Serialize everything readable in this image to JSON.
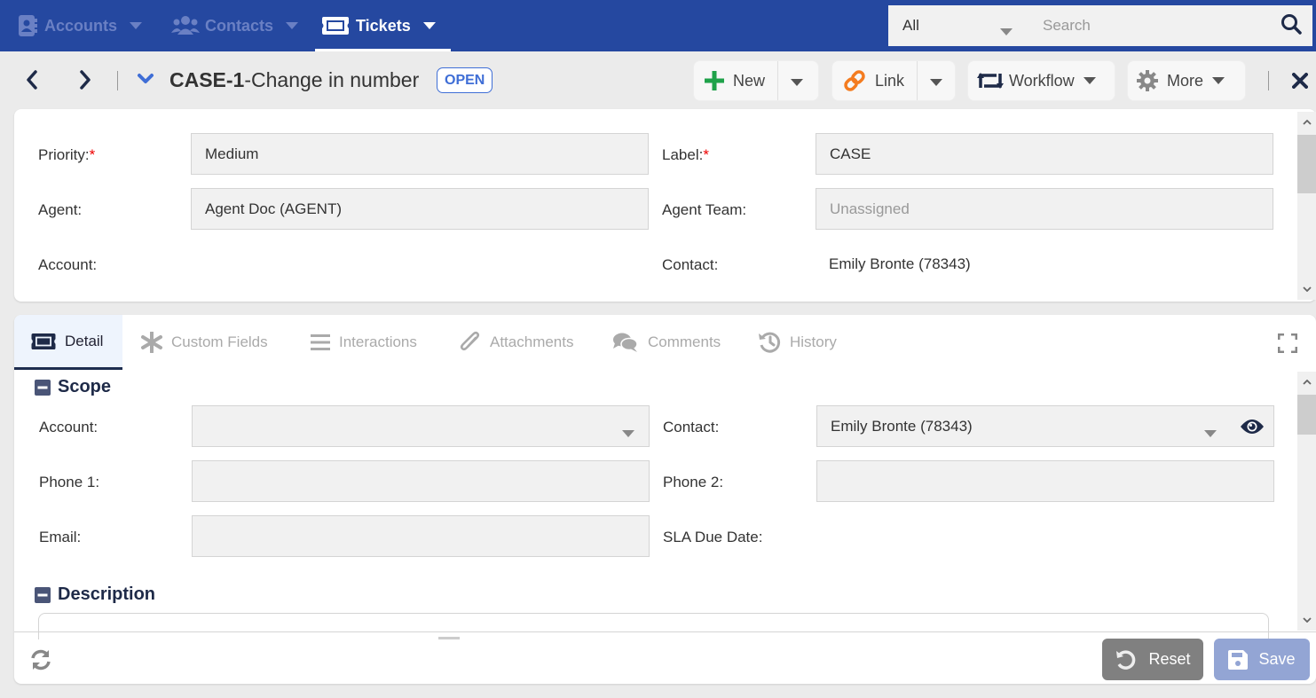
{
  "topnav": {
    "tabs": [
      {
        "label": "Accounts",
        "icon": "address-book-icon",
        "active": false
      },
      {
        "label": "Contacts",
        "icon": "users-icon",
        "active": false
      },
      {
        "label": "Tickets",
        "icon": "ticket-icon",
        "active": true
      }
    ],
    "search": {
      "scope_value": "All",
      "placeholder": "Search",
      "value": ""
    }
  },
  "titlebar": {
    "case_id": "CASE-1",
    "case_title": "-Change in number",
    "status": "OPEN",
    "buttons": {
      "new_label": "New",
      "link_label": "Link",
      "workflow_label": "Workflow",
      "more_label": "More"
    }
  },
  "header_fields": {
    "priority": {
      "label": "Priority:",
      "required": "*",
      "value": "Medium"
    },
    "label": {
      "label": "Label:",
      "required": "*",
      "value": "CASE"
    },
    "agent": {
      "label": "Agent:",
      "value": "Agent Doc (AGENT)"
    },
    "agent_team": {
      "label": "Agent Team:",
      "value": "Unassigned"
    },
    "account": {
      "label": "Account:",
      "value": ""
    },
    "contact": {
      "label": "Contact:",
      "value": "Emily Bronte (78343)"
    }
  },
  "detail_tabs": [
    {
      "label": "Detail",
      "icon": "ticket-icon",
      "active": true
    },
    {
      "label": "Custom Fields",
      "icon": "asterisk-icon",
      "active": false
    },
    {
      "label": "Interactions",
      "icon": "list-icon",
      "active": false
    },
    {
      "label": "Attachments",
      "icon": "paperclip-icon",
      "active": false
    },
    {
      "label": "Comments",
      "icon": "comments-icon",
      "active": false
    },
    {
      "label": "History",
      "icon": "history-icon",
      "active": false
    }
  ],
  "scope_section": {
    "title": "Scope",
    "account": {
      "label": "Account:",
      "value": ""
    },
    "contact": {
      "label": "Contact:",
      "value": "Emily Bronte (78343)"
    },
    "phone1": {
      "label": "Phone 1:",
      "value": ""
    },
    "phone2": {
      "label": "Phone 2:",
      "value": ""
    },
    "email": {
      "label": "Email:",
      "value": ""
    },
    "sla_due_date": {
      "label": "SLA Due Date:",
      "value": ""
    }
  },
  "description_section": {
    "title": "Description"
  },
  "footer": {
    "reset_label": "Reset",
    "save_label": "Save"
  },
  "colors": {
    "nav_bg": "#2548a0",
    "accent_blue": "#3f6ed6",
    "new_icon": "#1fa24a",
    "link_icon": "#f47c20",
    "reset_bg": "#808080",
    "save_bg": "#93a5d4"
  }
}
